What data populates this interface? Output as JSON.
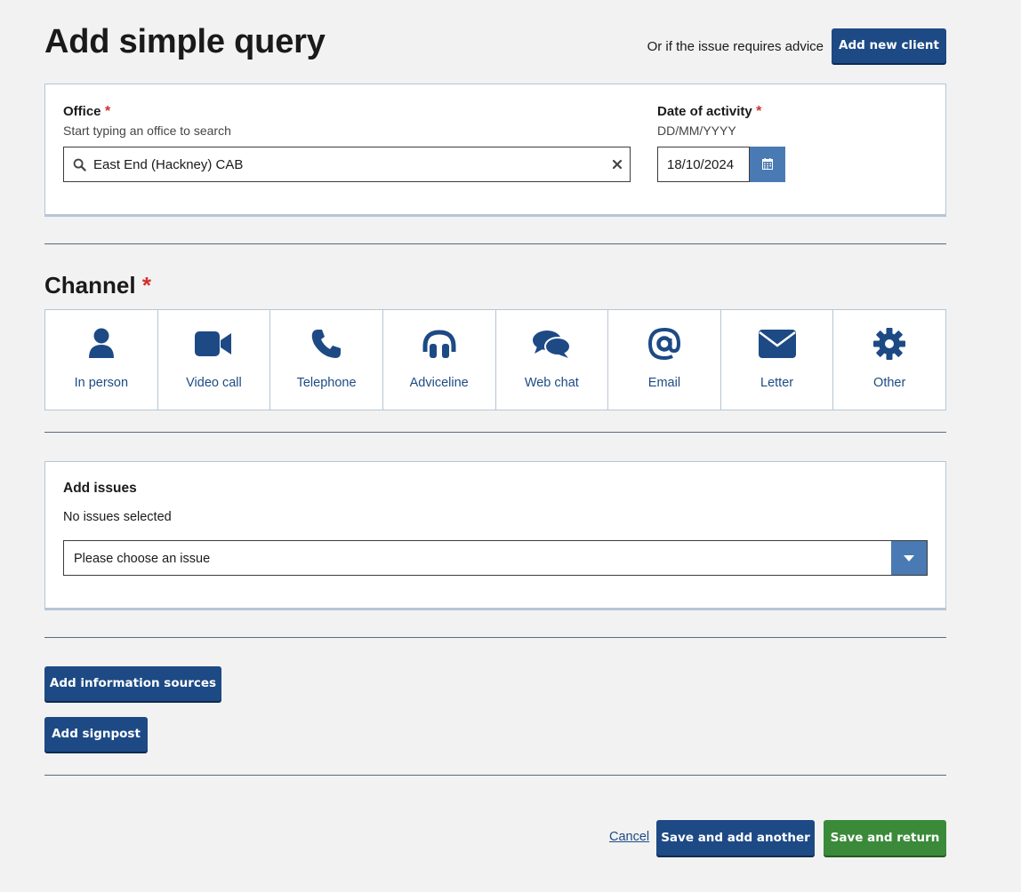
{
  "header": {
    "title": "Add simple query",
    "advice_text": "Or if the issue requires advice",
    "add_client_label": "Add new client"
  },
  "office": {
    "label": "Office",
    "required_mark": "*",
    "hint": "Start typing an office to search",
    "value": "East End (Hackney) CAB",
    "clear_icon": "close-icon",
    "search_icon": "search-icon"
  },
  "date": {
    "label": "Date of activity",
    "required_mark": "*",
    "hint": "DD/MM/YYYY",
    "value": "18/10/2024",
    "calendar_icon": "calendar-icon"
  },
  "channel": {
    "title": "Channel",
    "required_mark": "*",
    "options": [
      {
        "label": "In person",
        "icon": "person-icon"
      },
      {
        "label": "Video call",
        "icon": "video-camera-icon"
      },
      {
        "label": "Telephone",
        "icon": "phone-icon"
      },
      {
        "label": "Adviceline",
        "icon": "headset-icon"
      },
      {
        "label": "Web chat",
        "icon": "chat-bubbles-icon"
      },
      {
        "label": "Email",
        "icon": "at-sign-icon"
      },
      {
        "label": "Letter",
        "icon": "envelope-icon"
      },
      {
        "label": "Other",
        "icon": "gear-icon"
      }
    ]
  },
  "issues": {
    "title": "Add issues",
    "status": "No issues selected",
    "select_value": "Please choose an issue",
    "dropdown_icon": "chevron-down-icon"
  },
  "actions": {
    "info_sources_label": "Add information sources",
    "signpost_label": "Add signpost",
    "cancel_label": "Cancel",
    "save_add_label": "Save and add another",
    "save_return_label": "Save and return"
  },
  "colors": {
    "primary": "#1d4a85",
    "secondary_blue": "#4a7ab3",
    "success": "#3b8a3a",
    "required": "#d0312d",
    "background": "#f2f2f2"
  }
}
